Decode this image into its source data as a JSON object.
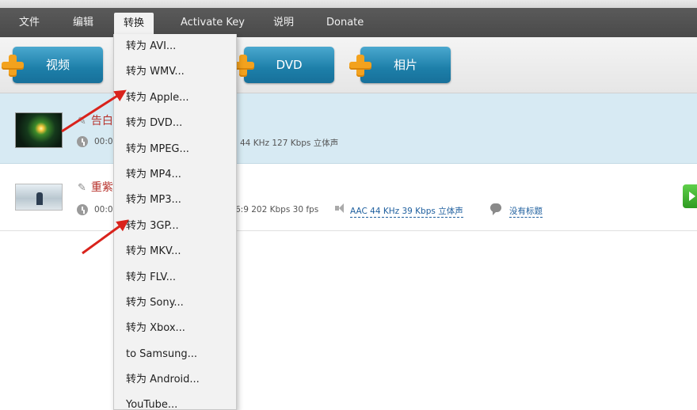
{
  "menubar": {
    "items": [
      "文件",
      "编辑",
      "转换",
      "Activate Key",
      "说明",
      "Donate"
    ]
  },
  "toolbar": {
    "video_label": "视频",
    "dvd_label": "DVD",
    "photo_label": "相片"
  },
  "files": [
    {
      "title": "告白",
      "duration": "00:0",
      "audio_info": "44 KHz  127 Kbps  立体声"
    },
    {
      "title": "重紫",
      "duration": "00:0",
      "video_info": "6:9  202 Kbps  30 fps",
      "audio_link": "AAC  44 KHz  39 Kbps  立体声",
      "subtitle_link": "没有标题"
    }
  ],
  "dropdown": {
    "items": [
      "转为 AVI...",
      "转为 WMV...",
      "转为 Apple...",
      "转为 DVD...",
      "转为 MPEG...",
      "转为 MP4...",
      "转为 MP3...",
      "转为 3GP...",
      "转为 MKV...",
      "转为 FLV...",
      "转为 Sony...",
      "转为 Xbox...",
      "to Samsung...",
      "转为 Android...",
      "YouTube..."
    ]
  },
  "colors": {
    "button_blue": "#1d7fa9",
    "plus_orange": "#f3a21e",
    "arrow_red": "#d9231c",
    "title_red": "#b7322c",
    "link_blue": "#1e5f9e"
  }
}
